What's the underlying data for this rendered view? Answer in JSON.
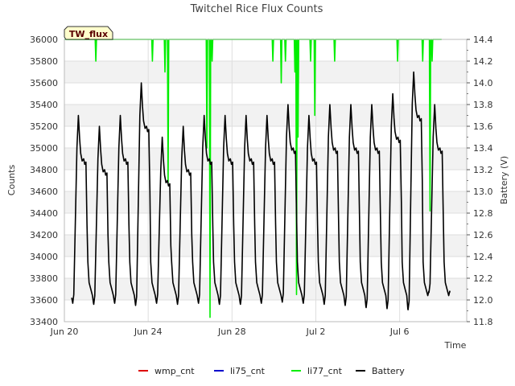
{
  "chart_data": {
    "type": "line",
    "title": "Twitchel Rice Flux Counts",
    "xlabel": "Time",
    "ylabel": "Counts",
    "y2label": "Battery (V)",
    "site_tag": "TW_flux",
    "xlim_days": [
      0,
      19.2
    ],
    "x_start_label": "Jun 20",
    "xticks": [
      {
        "day": 0,
        "label": "Jun 20"
      },
      {
        "day": 4,
        "label": "Jun 24"
      },
      {
        "day": 8,
        "label": "Jun 28"
      },
      {
        "day": 12,
        "label": "Jul 2"
      },
      {
        "day": 16,
        "label": "Jul 6"
      }
    ],
    "ylim": [
      33400,
      36000
    ],
    "yticks": [
      33400,
      33600,
      33800,
      34000,
      34200,
      34400,
      34600,
      34800,
      35000,
      35200,
      35400,
      35600,
      35800,
      36000
    ],
    "y2lim": [
      11.8,
      14.4
    ],
    "y2ticks": [
      11.8,
      12.0,
      12.2,
      12.4,
      12.6,
      12.8,
      13.0,
      13.2,
      13.4,
      13.6,
      13.8,
      14.0,
      14.2,
      14.4
    ],
    "grid": true,
    "legend_position": "bottom",
    "series": [
      {
        "name": "wmp_cnt",
        "color": "#dd0000",
        "axis": "left",
        "points": []
      },
      {
        "name": "li75_cnt",
        "color": "#0000cc",
        "axis": "left",
        "points": []
      },
      {
        "name": "li77_cnt",
        "color": "#00ee00",
        "axis": "left",
        "baseline": 36000,
        "x_range": [
          0,
          18.0
        ],
        "dips": [
          {
            "day": 1.5,
            "value": 35800
          },
          {
            "day": 4.2,
            "value": 35800
          },
          {
            "day": 4.8,
            "value": 35700
          },
          {
            "day": 4.95,
            "value": 34680
          },
          {
            "day": 6.8,
            "value": 35000
          },
          {
            "day": 6.95,
            "value": 33440
          },
          {
            "day": 7.05,
            "value": 35800
          },
          {
            "day": 9.95,
            "value": 35800
          },
          {
            "day": 10.35,
            "value": 35600
          },
          {
            "day": 10.55,
            "value": 35800
          },
          {
            "day": 11.0,
            "value": 35700
          },
          {
            "day": 11.08,
            "value": 33650
          },
          {
            "day": 11.15,
            "value": 35100
          },
          {
            "day": 11.75,
            "value": 35800
          },
          {
            "day": 11.95,
            "value": 35300
          },
          {
            "day": 12.9,
            "value": 35800
          },
          {
            "day": 15.9,
            "value": 35800
          },
          {
            "day": 17.1,
            "value": 35800
          },
          {
            "day": 17.45,
            "value": 34420
          },
          {
            "day": 17.55,
            "value": 35800
          }
        ]
      },
      {
        "name": "Battery",
        "color": "#000000",
        "axis": "right",
        "units": "V",
        "cycle_days": 1.0,
        "start_day": 0.4,
        "peaks": [
          13.7,
          13.6,
          13.7,
          14.0,
          13.5,
          13.6,
          13.7,
          13.7,
          13.7,
          13.7,
          13.8,
          13.7,
          13.8,
          13.8,
          13.8,
          13.9,
          14.1,
          13.8
        ],
        "troughs": [
          11.97,
          11.96,
          11.97,
          11.95,
          11.97,
          11.96,
          11.97,
          11.96,
          11.96,
          11.97,
          11.98,
          11.97,
          11.96,
          11.95,
          11.93,
          11.92,
          11.91,
          12.07
        ]
      }
    ]
  }
}
